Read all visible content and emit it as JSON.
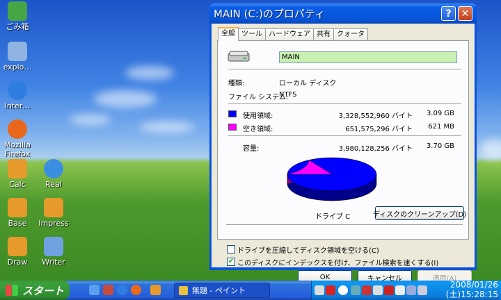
{
  "desktop": {
    "icons": [
      {
        "label": "ごみ箱",
        "icon": "recycle-bin-icon",
        "color": "#46a646"
      },
      {
        "label": "explo…",
        "icon": "computer-icon",
        "color": "#8fb4e2"
      },
      {
        "label": "Inter…",
        "icon": "internet-explorer-icon",
        "color": "#2f7de1"
      },
      {
        "label": "Mozilla Firefox",
        "icon": "firefox-icon",
        "color": "#e9681c"
      },
      {
        "label": "Calc",
        "icon": "calc-icon",
        "color": "#e59a2b"
      },
      {
        "label": "Real",
        "icon": "realplayer-icon",
        "color": "#3a8fe0"
      },
      {
        "label": "Base",
        "icon": "base-icon",
        "color": "#e59a2b"
      },
      {
        "label": "Impress",
        "icon": "impress-icon",
        "color": "#e59a2b"
      },
      {
        "label": "Draw",
        "icon": "draw-icon",
        "color": "#e59a2b"
      },
      {
        "label": "Writer",
        "icon": "writer-icon",
        "color": "#6fa0e0"
      }
    ]
  },
  "dialog": {
    "title": "MAIN (C:)のプロパティ",
    "help_button": "?",
    "close_button": "✕",
    "tabs": [
      "全般",
      "ツール",
      "ハードウェア",
      "共有",
      "クォータ"
    ],
    "drive_name": "MAIN",
    "type_label": "種類:",
    "type_value": "ローカル ディスク",
    "fs_label": "ファイル システム:",
    "fs_value": "NTFS",
    "used_label": "使用領域:",
    "used_bytes": "3,328,552,960 バイト",
    "used_size": "3.09 GB",
    "used_color": "#0000ff",
    "free_label": "空き領域:",
    "free_bytes": "651,575,296 バイト",
    "free_size": "621 MB",
    "free_color": "#ff00ff",
    "capacity_label": "容量:",
    "capacity_bytes": "3,980,128,256 バイト",
    "capacity_size": "3.70 GB",
    "drive_label": "ドライブ C",
    "cleanup_button": "ディスクのクリーンアップ(D)",
    "compress_label": "ドライブを圧縮してディスク領域を空ける(C)",
    "compress_checked": false,
    "index_label": "このディスクにインデックスを付け、ファイル検索を速くする(I)",
    "index_checked": true,
    "ok_button": "OK",
    "cancel_button": "キャンセル",
    "apply_button": "適用(A)",
    "used_fraction": 0.8363
  },
  "taskbar": {
    "start_label": "スタート",
    "task_label": "無題 - ペイント",
    "clock_date": "2008/01/26",
    "clock_time": "(土)15:28:15"
  }
}
